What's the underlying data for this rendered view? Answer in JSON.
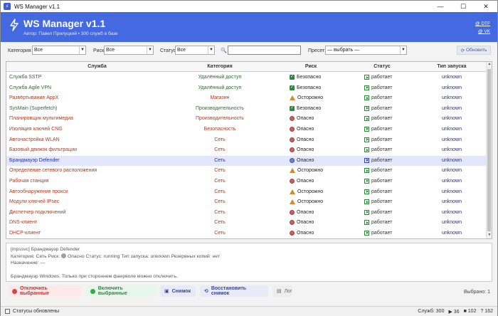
{
  "window": {
    "title": "WS Manager v1.1",
    "minimize": "—",
    "maximize": "☐",
    "close": "✕"
  },
  "header": {
    "title": "WS Manager v1.1",
    "subtitle": "Автор: Павел Прилуцкий  •  300 служб в базе",
    "link1": "@ DTF",
    "link2": "@ VK"
  },
  "filters": {
    "category_label": "Категория",
    "category_value": "Все",
    "risk_label": "Риск:",
    "risk_value": "Все",
    "status_label": "Статус:",
    "status_value": "Все",
    "search_value": "",
    "preset_label": "Пресет:",
    "preset_value": "— выбрать —",
    "refresh_label": "Обновить"
  },
  "table": {
    "headers": {
      "service": "Служба",
      "category": "Категория",
      "risk": "Риск",
      "status": "Статус",
      "startup": "Тип запуска"
    },
    "rows": [
      {
        "service": "Служба SSTP",
        "category": "Удалённый доступ",
        "risk": "Безопасно",
        "risk_kind": "safe",
        "status": "работает",
        "startup": "unknown",
        "tone": "green"
      },
      {
        "service": "Служба Agile VPN",
        "category": "Удалённый доступ",
        "risk": "Безопасно",
        "risk_kind": "safe",
        "status": "работает",
        "startup": "unknown",
        "tone": "green"
      },
      {
        "service": "Развёртывание AppX",
        "category": "Магазин",
        "risk": "Осторожно",
        "risk_kind": "warn",
        "status": "работает",
        "startup": "unknown",
        "tone": "red"
      },
      {
        "service": "SysMain (Superfetch)",
        "category": "Производительность",
        "risk": "Безопасно",
        "risk_kind": "safe",
        "status": "работает",
        "startup": "unknown",
        "tone": "green"
      },
      {
        "service": "Планировщик мультимедиа",
        "category": "Производительность",
        "risk": "Опасно",
        "risk_kind": "danger",
        "status": "работает",
        "startup": "unknown",
        "tone": "red"
      },
      {
        "service": "Изоляция ключей CNG",
        "category": "Безопасность",
        "risk": "Опасно",
        "risk_kind": "danger",
        "status": "работает",
        "startup": "unknown",
        "tone": "red"
      },
      {
        "service": "Автонастройка WLAN",
        "category": "Сеть",
        "risk": "Опасно",
        "risk_kind": "danger",
        "status": "работает",
        "startup": "unknown",
        "tone": "red"
      },
      {
        "service": "Базовый движок фильтрации",
        "category": "Сеть",
        "risk": "Опасно",
        "risk_kind": "danger",
        "status": "работает",
        "startup": "unknown",
        "tone": "red"
      },
      {
        "service": "Брандмауэр Defender",
        "category": "Сеть",
        "risk": "Опасно",
        "risk_kind": "danger",
        "status": "работает",
        "startup": "unknown",
        "tone": "blue",
        "selected": true
      },
      {
        "service": "Определение сетевого расположения",
        "category": "Сеть",
        "risk": "Осторожно",
        "risk_kind": "warn",
        "status": "работает",
        "startup": "unknown",
        "tone": "red"
      },
      {
        "service": "Рабочая станция",
        "category": "Сеть",
        "risk": "Опасно",
        "risk_kind": "danger",
        "status": "работает",
        "startup": "unknown",
        "tone": "red"
      },
      {
        "service": "Автообнаружение прокси",
        "category": "Сеть",
        "risk": "Осторожно",
        "risk_kind": "warn",
        "status": "работает",
        "startup": "unknown",
        "tone": "red"
      },
      {
        "service": "Модули ключей IPsec",
        "category": "Сеть",
        "risk": "Осторожно",
        "risk_kind": "warn",
        "status": "работает",
        "startup": "unknown",
        "tone": "red"
      },
      {
        "service": "Диспетчер подключений",
        "category": "Сеть",
        "risk": "Опасно",
        "risk_kind": "danger",
        "status": "работает",
        "startup": "unknown",
        "tone": "red"
      },
      {
        "service": "DNS-клиент",
        "category": "Сеть",
        "risk": "Опасно",
        "risk_kind": "danger",
        "status": "работает",
        "startup": "unknown",
        "tone": "red"
      },
      {
        "service": "DHCP-клиент",
        "category": "Сеть",
        "risk": "Опасно",
        "risk_kind": "danger",
        "status": "работает",
        "startup": "unknown",
        "tone": "red"
      }
    ]
  },
  "details": {
    "line1": "[mpssvc]  Брандмауэр Defender",
    "line2a": "Категория: Сеть   Риск:",
    "line2b": "Опасно   Статус: running   Тип запуска: unknown   Резервных копий: нет",
    "line3": "Назначение: —",
    "line5": "Брандмауэр Windows. Только при стороннем фаерволе можно отключить."
  },
  "actions": {
    "disable": "Отключить выбранные",
    "enable": "Включить выбранные",
    "snapshot": "Снимок",
    "restore": "Восстановить снимок",
    "log": "Лог",
    "selected": "Выбрано: 1"
  },
  "statusbar": {
    "message": "Статусы обновлены",
    "services": "Служб: 300",
    "running": "36",
    "stopped": "102",
    "other": "? 162"
  },
  "colors": {
    "accent": "#4469e0",
    "danger": "#c53030",
    "success": "#2f8a3e"
  }
}
